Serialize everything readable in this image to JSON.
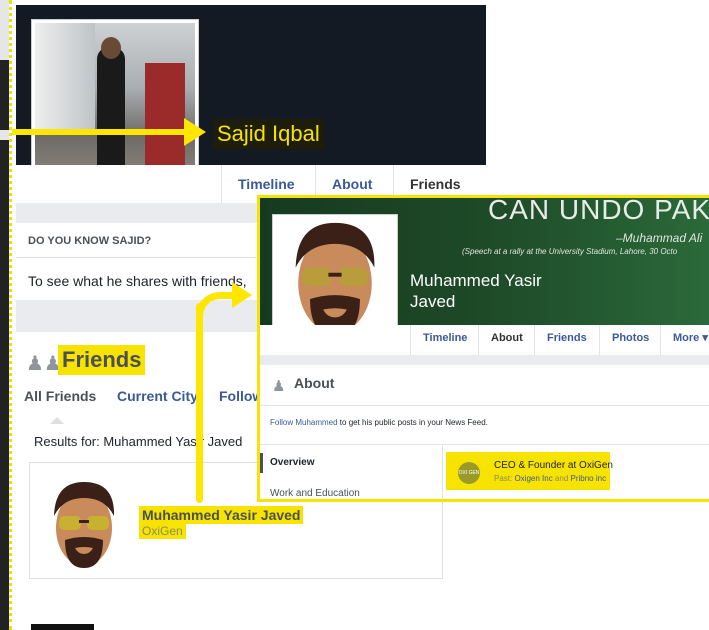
{
  "main_profile": {
    "name": "Sajid Iqbal",
    "tabs": [
      "Timeline",
      "About",
      "Friends"
    ],
    "know_heading": "DO YOU KNOW SAJID?",
    "see_text": "To see what he shares with friends,"
  },
  "friends": {
    "heading": "Friends",
    "tabs": [
      "All Friends",
      "Current City",
      "Follow"
    ],
    "results": "Results for: Muhammed Yasir Javed",
    "card": {
      "name": "Muhammed Yasir Javed",
      "subtitle": "OxiGen"
    }
  },
  "overlay_profile": {
    "cover_quote": "CAN UNDO PAKIS",
    "attribution": "–Muhammad Ali",
    "speech": "(Speech at a rally at the University Stadium, Lahore, 30 Octo",
    "name_line1": "Muhammed Yasir",
    "name_line2": "Javed",
    "tabs": [
      "Timeline",
      "About",
      "Friends",
      "Photos",
      "More ▾"
    ],
    "about_heading": "About",
    "follow_link": "Follow Muhammed",
    "follow_rest": " to get his public posts in your News Feed.",
    "sidebar": [
      "Overview",
      "Work and Education"
    ],
    "job": {
      "logo": "OXI GEN",
      "title": "CEO & Founder at OxiGen",
      "past_prefix": "Past: ",
      "past_a": "Oxigen Inc",
      "past_and": " and ",
      "past_b": "Pribno inc"
    }
  },
  "colors": {
    "highlight": "#f7e300",
    "link": "#3b5998",
    "cover_dark": "#141a24"
  }
}
